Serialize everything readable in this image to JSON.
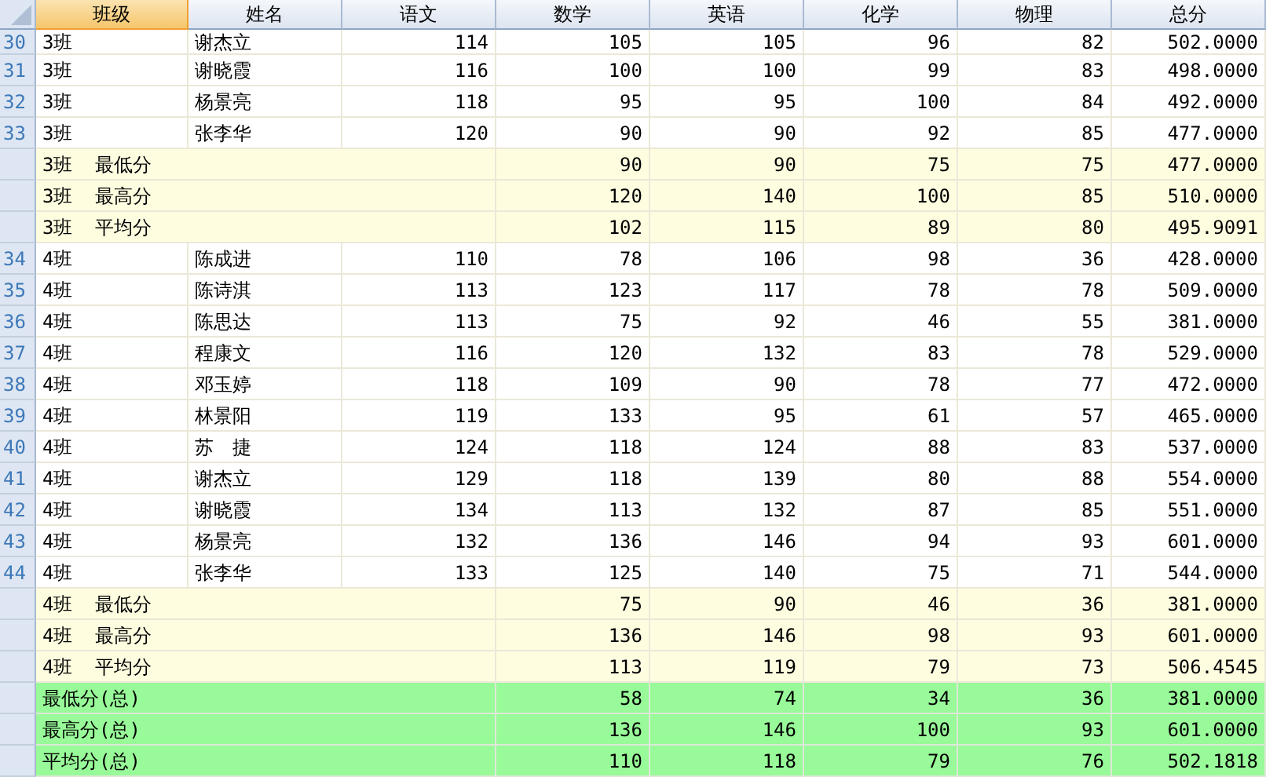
{
  "columns": [
    {
      "label": "班级",
      "selected": true
    },
    {
      "label": "姓名",
      "selected": false
    },
    {
      "label": "语文",
      "selected": false
    },
    {
      "label": "数学",
      "selected": false
    },
    {
      "label": "英语",
      "selected": false
    },
    {
      "label": "化学",
      "selected": false
    },
    {
      "label": "物理",
      "selected": false
    },
    {
      "label": "总分",
      "selected": false
    }
  ],
  "rows": [
    {
      "kind": "student",
      "number": "30",
      "cells": [
        "3班",
        "谢杰立",
        "114",
        "105",
        "105",
        "96",
        "82",
        "502.0000"
      ]
    },
    {
      "kind": "student",
      "number": "31",
      "cells": [
        "3班",
        "谢晓霞",
        "116",
        "100",
        "100",
        "99",
        "83",
        "498.0000"
      ]
    },
    {
      "kind": "student",
      "number": "32",
      "cells": [
        "3班",
        "杨景亮",
        "118",
        "95",
        "95",
        "100",
        "84",
        "492.0000"
      ]
    },
    {
      "kind": "student",
      "number": "33",
      "cells": [
        "3班",
        "张李华",
        "120",
        "90",
        "90",
        "92",
        "85",
        "477.0000"
      ]
    },
    {
      "kind": "group",
      "label": "3班  最低分",
      "cells": [
        "90",
        "90",
        "75",
        "75",
        "477.0000"
      ]
    },
    {
      "kind": "group",
      "label": "3班  最高分",
      "cells": [
        "120",
        "140",
        "100",
        "85",
        "510.0000"
      ]
    },
    {
      "kind": "group",
      "label": "3班  平均分",
      "cells": [
        "102",
        "115",
        "89",
        "80",
        "495.9091"
      ]
    },
    {
      "kind": "student",
      "number": "34",
      "cells": [
        "4班",
        "陈成进",
        "110",
        "78",
        "106",
        "98",
        "36",
        "428.0000"
      ]
    },
    {
      "kind": "student",
      "number": "35",
      "cells": [
        "4班",
        "陈诗淇",
        "113",
        "123",
        "117",
        "78",
        "78",
        "509.0000"
      ]
    },
    {
      "kind": "student",
      "number": "36",
      "cells": [
        "4班",
        "陈思达",
        "113",
        "75",
        "92",
        "46",
        "55",
        "381.0000"
      ]
    },
    {
      "kind": "student",
      "number": "37",
      "cells": [
        "4班",
        "程康文",
        "116",
        "120",
        "132",
        "83",
        "78",
        "529.0000"
      ]
    },
    {
      "kind": "student",
      "number": "38",
      "cells": [
        "4班",
        "邓玉婷",
        "118",
        "109",
        "90",
        "78",
        "77",
        "472.0000"
      ]
    },
    {
      "kind": "student",
      "number": "39",
      "cells": [
        "4班",
        "林景阳",
        "119",
        "133",
        "95",
        "61",
        "57",
        "465.0000"
      ]
    },
    {
      "kind": "student",
      "number": "40",
      "cells": [
        "4班",
        "苏　捷",
        "124",
        "118",
        "124",
        "88",
        "83",
        "537.0000"
      ]
    },
    {
      "kind": "student",
      "number": "41",
      "cells": [
        "4班",
        "谢杰立",
        "129",
        "118",
        "139",
        "80",
        "88",
        "554.0000"
      ]
    },
    {
      "kind": "student",
      "number": "42",
      "cells": [
        "4班",
        "谢晓霞",
        "134",
        "113",
        "132",
        "87",
        "85",
        "551.0000"
      ]
    },
    {
      "kind": "student",
      "number": "43",
      "cells": [
        "4班",
        "杨景亮",
        "132",
        "136",
        "146",
        "94",
        "93",
        "601.0000"
      ]
    },
    {
      "kind": "student",
      "number": "44",
      "cells": [
        "4班",
        "张李华",
        "133",
        "125",
        "140",
        "75",
        "71",
        "544.0000"
      ]
    },
    {
      "kind": "group",
      "label": "4班  最低分",
      "cells": [
        "75",
        "90",
        "46",
        "36",
        "381.0000"
      ]
    },
    {
      "kind": "group",
      "label": "4班  最高分",
      "cells": [
        "136",
        "146",
        "98",
        "93",
        "601.0000"
      ]
    },
    {
      "kind": "group",
      "label": "4班  平均分",
      "cells": [
        "113",
        "119",
        "79",
        "73",
        "506.4545"
      ]
    },
    {
      "kind": "total",
      "label": "最低分(总)",
      "cells": [
        "58",
        "74",
        "34",
        "36",
        "381.0000"
      ]
    },
    {
      "kind": "total",
      "label": "最高分(总)",
      "cells": [
        "136",
        "146",
        "100",
        "93",
        "601.0000"
      ]
    },
    {
      "kind": "total",
      "label": "平均分(总)",
      "cells": [
        "110",
        "118",
        "79",
        "76",
        "502.1818"
      ]
    }
  ]
}
